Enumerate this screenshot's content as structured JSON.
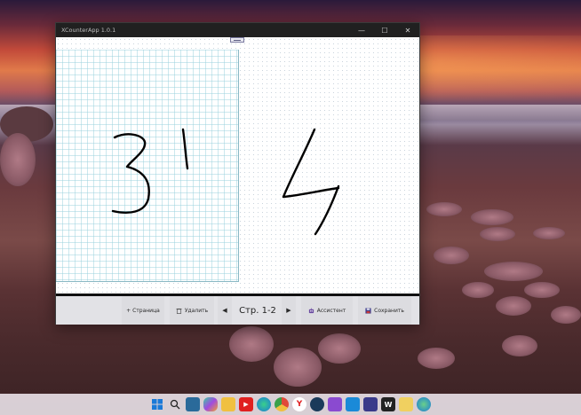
{
  "window": {
    "title": "XCounterApp 1.0.1",
    "controls": {
      "minimize": "—",
      "maximize": "☐",
      "close": "✕"
    }
  },
  "canvas": {
    "handwriting": [
      "3",
      "1",
      "4"
    ]
  },
  "toolbar": {
    "add_page": "+ Страница",
    "delete": "Удалить",
    "prev": "◀",
    "page_label": "Стр. 1-2",
    "next": "▶",
    "assistant": "Ассистент",
    "save": "Сохранить"
  },
  "taskbar": {
    "icons": [
      "windows-start",
      "search",
      "terminal",
      "copilot",
      "file-explorer",
      "youtube",
      "edge",
      "chrome",
      "yandex",
      "steam",
      "visual-studio",
      "vscode",
      "save",
      "app-w",
      "notes",
      "globe"
    ]
  },
  "colors": {
    "toolbar_bg": "#e2e2e6",
    "titlebar_bg": "#202020",
    "grid_line": "#9ad1dc",
    "ink": "#000000"
  }
}
